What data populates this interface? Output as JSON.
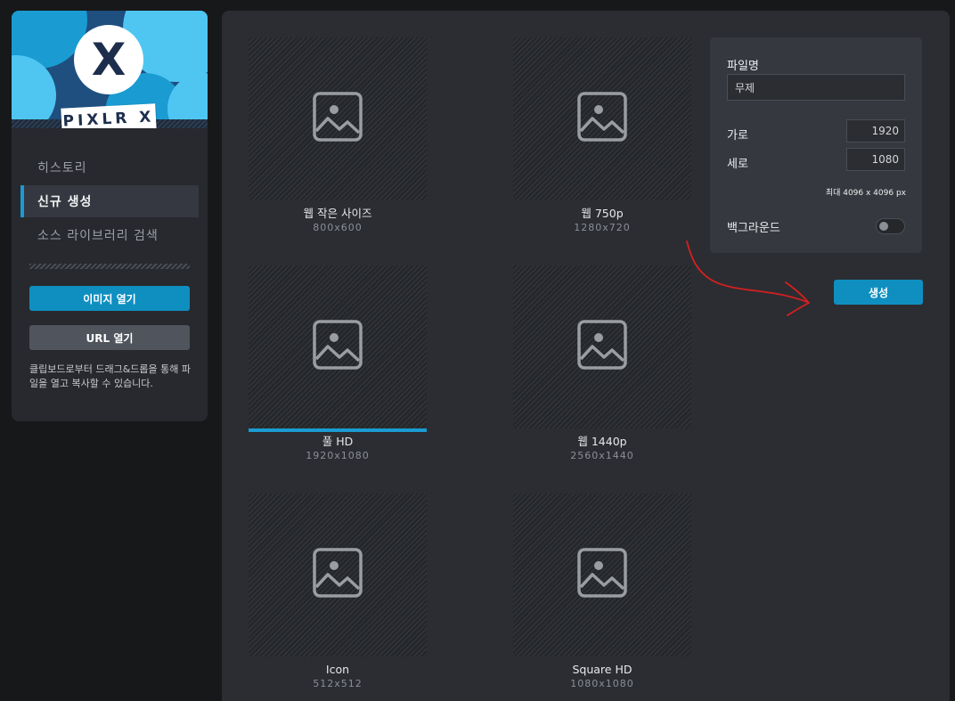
{
  "app": {
    "logo_letter": "X",
    "logo_text": "PIXLR X",
    "accent_color": "#1a9bd2",
    "logo_colors": {
      "dark": "#1e4f7f",
      "mid": "#1a9bd2",
      "light": "#4fc6f2"
    }
  },
  "sidebar": {
    "nav": [
      {
        "label": "히스토리",
        "active": false
      },
      {
        "label": "신규 생성",
        "active": true
      },
      {
        "label": "소스 라이브러리 검색",
        "active": false
      }
    ],
    "open_image_label": "이미지 열기",
    "open_url_label": "URL 열기",
    "help_text": "클립보드로부터 드래그&드롭을 통해 파일을 열고 복사할 수 있습니다."
  },
  "presets": [
    {
      "name": "웹 작은 사이즈",
      "size": "800x600",
      "icon": "image-icon",
      "selected": false
    },
    {
      "name": "웹 750p",
      "size": "1280x720",
      "icon": "image-icon",
      "selected": false
    },
    {
      "name": "풀 HD",
      "size": "1920x1080",
      "icon": "image-icon",
      "selected": true
    },
    {
      "name": "웹 1440p",
      "size": "2560x1440",
      "icon": "image-icon",
      "selected": false
    },
    {
      "name": "Icon",
      "size": "512x512",
      "icon": "image-icon",
      "selected": false
    },
    {
      "name": "Square HD",
      "size": "1080x1080",
      "icon": "image-icon",
      "selected": false
    }
  ],
  "settings": {
    "filename_label": "파일명",
    "filename_value": "무제",
    "width_label": "가로",
    "width_value": "1920",
    "height_label": "세로",
    "height_value": "1080",
    "max_note": "최대 4096 x 4096 px",
    "background_label": "백그라운드",
    "background_enabled": false
  },
  "create_label": "생성",
  "annotation": {
    "color": "#d42020",
    "icon": "red-arrow-annotation"
  }
}
